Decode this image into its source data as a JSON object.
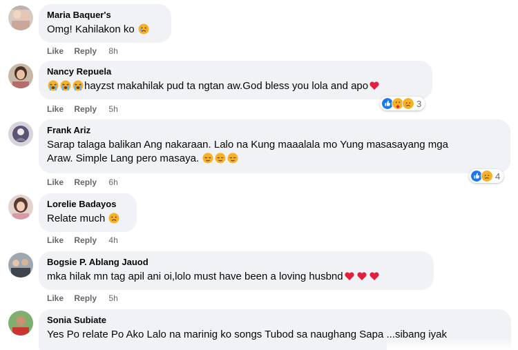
{
  "actions": {
    "like_label": "Like",
    "reply_label": "Reply"
  },
  "colors": {
    "bubble": "#f0f2f5",
    "meta_text": "#65676b",
    "like_blue": "#1877f2",
    "heart_red": "#e41e3f",
    "emoji_yellow": "#f7b125"
  },
  "comments": [
    {
      "author": "Maria Baquer's",
      "text": "Omg! Kahilakon ko",
      "emojis": [
        "crying-face"
      ],
      "time": "8h"
    },
    {
      "author": "Nancy Repuela",
      "text": "hayzst makahilak pud ta ngtan aw.God bless you lola and apo",
      "leading_emojis": [
        "loudly-crying-face",
        "loudly-crying-face",
        "loudly-crying-face"
      ],
      "trailing_emojis": [
        "red-heart"
      ],
      "time": "5h",
      "reactions": {
        "icons": [
          "like",
          "care",
          "sad"
        ],
        "count": "3"
      }
    },
    {
      "author": "Frank Ariz",
      "text_line1": "Sarap talaga balikan Ang nakaraan. Lalo na Kung maaalala mo Yung masasayang mga",
      "text_line2": "Araw. Simple Lang pero masaya.",
      "emojis": [
        "relieved-face",
        "relieved-face",
        "relieved-face"
      ],
      "time": "6h",
      "reactions": {
        "icons": [
          "like",
          "sad"
        ],
        "count": "4"
      }
    },
    {
      "author": "Lorelie Badayos",
      "text": "Relate much",
      "emojis": [
        "sad-face"
      ],
      "time": "4h"
    },
    {
      "author": "Bogsie P. Ablang Jauod",
      "text": "mka hilak mn tag apil ani oi,lolo must have been a loving husbnd",
      "emojis": [
        "red-heart",
        "red-heart",
        "red-heart"
      ],
      "time": "5h"
    },
    {
      "author": "Sonia Subiate",
      "text": "Yes Po relate Po Ako Lalo na marinig ko songs Tubod sa naughang Sapa ...sibang iyak"
    }
  ]
}
